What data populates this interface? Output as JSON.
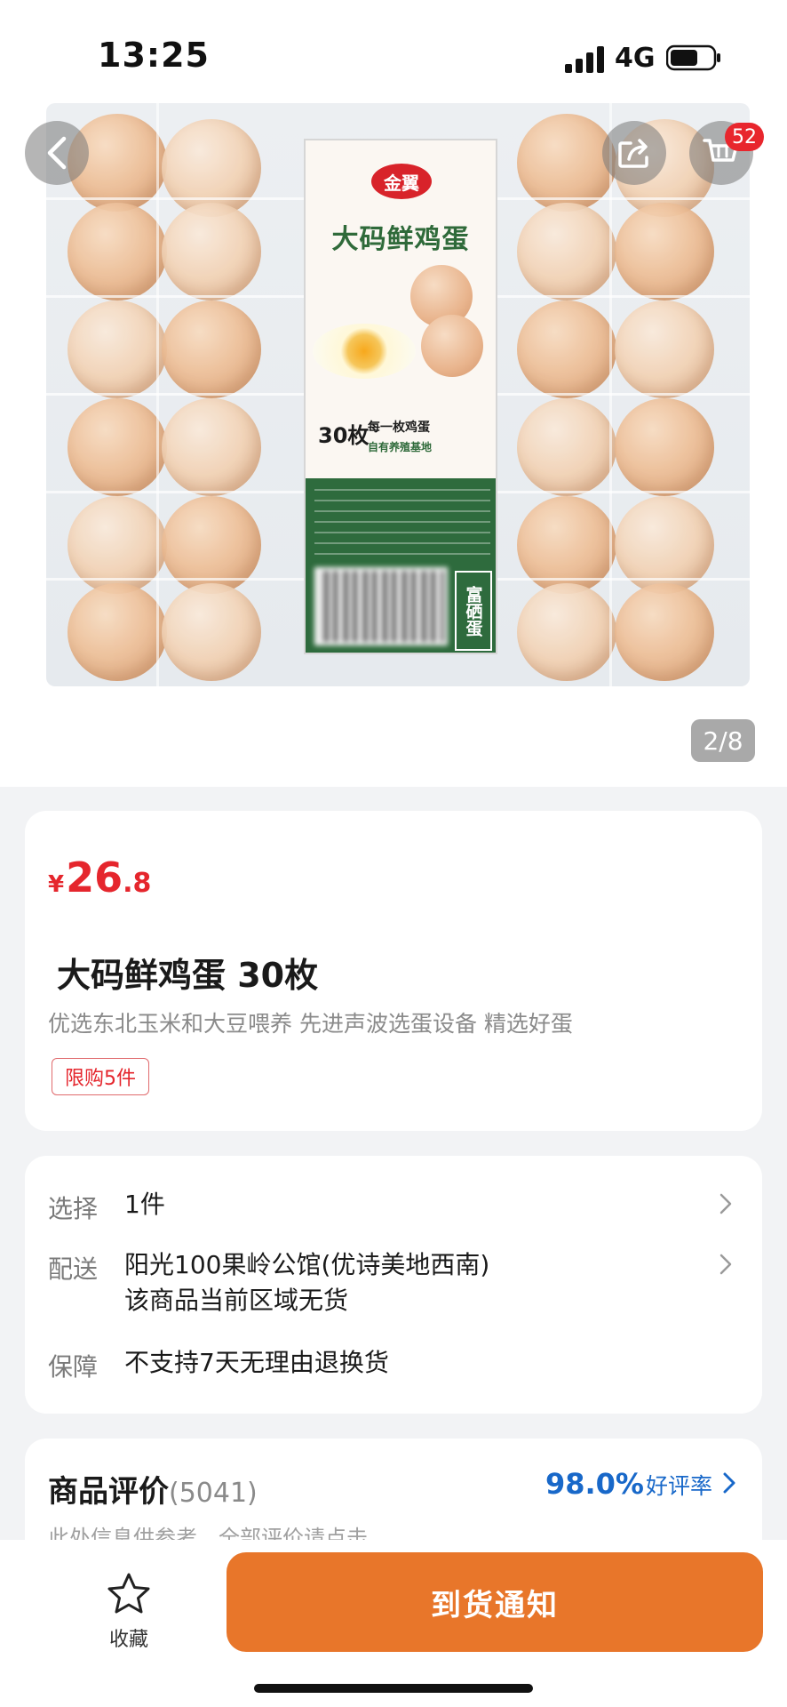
{
  "status_bar": {
    "time": "13:25",
    "network": "4G"
  },
  "gallery": {
    "page_indicator": "2/8",
    "cart_badge": "52",
    "label_logo": "金翼",
    "label_title": "大码鲜鸡蛋",
    "label_count": "30枚",
    "label_tag": "每一枚鸡蛋",
    "label_tag2": "自有养殖基地",
    "label_side": "富硒蛋"
  },
  "product": {
    "price_symbol": "¥",
    "price_integer": "26",
    "price_decimal": ".8",
    "title": "大码鲜鸡蛋 30枚",
    "subtitle": "优选东北玉米和大豆喂养 先进声波选蛋设备 精选好蛋",
    "limit_tag": "限购5件"
  },
  "info": {
    "select_label": "选择",
    "select_value": "1件",
    "delivery_label": "配送",
    "delivery_address": "阳光100果岭公馆(优诗美地西南)",
    "delivery_status": "该商品当前区域无货",
    "guarantee_label": "保障",
    "guarantee_value": "不支持7天无理由退换货"
  },
  "reviews": {
    "title": "商品评价",
    "count": "(5041)",
    "rate": "98.0%",
    "rate_label": "好评率",
    "hint": "此处信息供参考，全部评价请点击"
  },
  "bottom_bar": {
    "favorite_label": "收藏",
    "notify_label": "到货通知"
  },
  "colors": {
    "price": "#e5262d",
    "notify_button": "#e8762a",
    "rating": "#1868c9"
  }
}
